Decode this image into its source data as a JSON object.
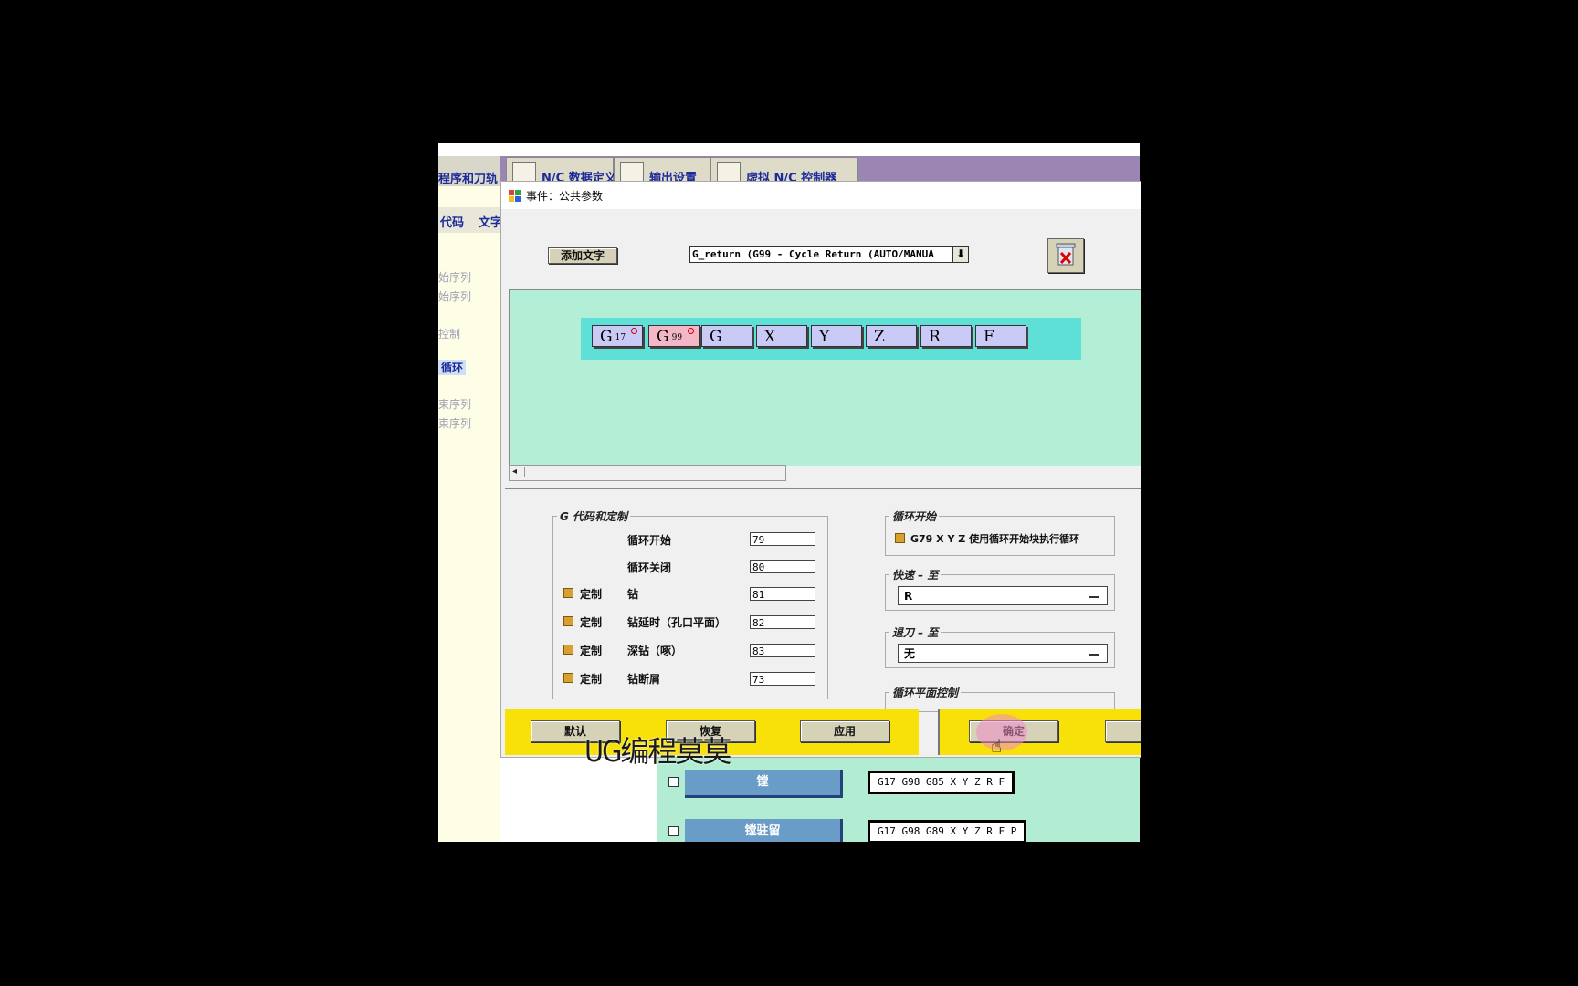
{
  "background_app": {
    "left_tab_label": "程序和刀轨",
    "left_subtabs": [
      "代码",
      "文字"
    ],
    "left_items": [
      "始序列",
      "始序列",
      "控制",
      "循环",
      "束序列",
      "束序列"
    ],
    "main_tabs": [
      "N/C 数据定义",
      "输出设置",
      "虚拟 N/C 控制器"
    ],
    "tree": [
      {
        "label": "镗",
        "code": "G17  G98  G85  X  Y  Z  R  F"
      },
      {
        "label": "镗驻留",
        "code": "G17  G98  G89  X  Y  Z  R  F  P"
      }
    ]
  },
  "dialog": {
    "title": "事件：公共参数",
    "add_text_button": "添加文字",
    "event_select": "G_return (G99 - Cycle Return (AUTO/MANUA",
    "words": [
      {
        "letter": "G",
        "sub": "17",
        "marked": true,
        "highlight": false
      },
      {
        "letter": "G",
        "sub": "99",
        "marked": true,
        "highlight": true
      },
      {
        "letter": "G",
        "sub": "",
        "marked": false,
        "highlight": false
      },
      {
        "letter": "X",
        "sub": "",
        "marked": false,
        "highlight": false
      },
      {
        "letter": "Y",
        "sub": "",
        "marked": false,
        "highlight": false
      },
      {
        "letter": "Z",
        "sub": "",
        "marked": false,
        "highlight": false
      },
      {
        "letter": "R",
        "sub": "",
        "marked": false,
        "highlight": false
      },
      {
        "letter": "F",
        "sub": "",
        "marked": false,
        "highlight": false
      }
    ],
    "gcode_group": {
      "title": "G 代码和定制",
      "custom_label": "定制",
      "rows": [
        {
          "label": "循环开始",
          "value": "79",
          "custom": false
        },
        {
          "label": "循环关闭",
          "value": "80",
          "custom": false
        },
        {
          "label": "钻",
          "value": "81",
          "custom": true
        },
        {
          "label": "钻延时（孔口平面）",
          "value": "82",
          "custom": true
        },
        {
          "label": "深钻（啄）",
          "value": "83",
          "custom": true
        },
        {
          "label": "钻断屑",
          "value": "73",
          "custom": true
        }
      ]
    },
    "cycle_start": {
      "title": "循环开始",
      "option": "G79 X Y Z  使用循环开始块执行循环"
    },
    "rapid_to": {
      "title": "快速 – 至",
      "value": "R"
    },
    "retract_to": {
      "title": "退刀 – 至",
      "value": "无"
    },
    "cycle_plane": {
      "title": "循环平面控制"
    },
    "buttons": {
      "default": "默认",
      "restore": "恢复",
      "apply": "应用",
      "ok": "确定"
    }
  },
  "watermark": "UG编程莫莫",
  "colors": {
    "canvas": "#b3eed6",
    "footer": "#f7e109",
    "word_bg": "#c9cbf6",
    "word_highlight": "#f4b7c8"
  }
}
